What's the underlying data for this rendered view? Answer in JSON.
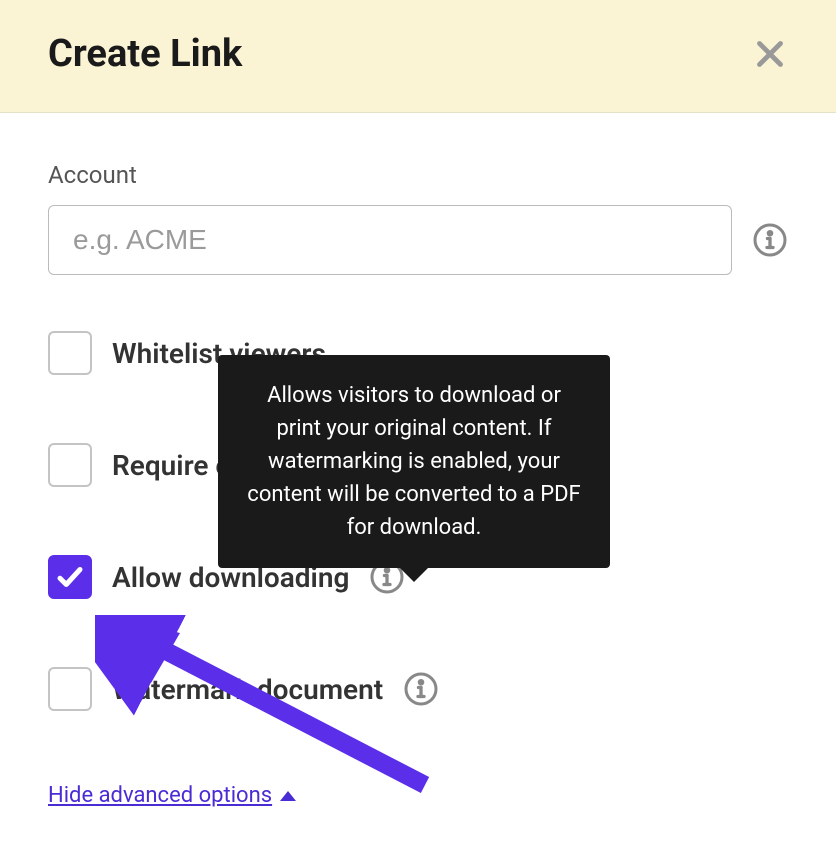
{
  "header": {
    "title": "Create Link"
  },
  "account": {
    "label": "Account",
    "placeholder": "e.g. ACME",
    "value": ""
  },
  "options": {
    "whitelist": {
      "label": "Whitelist viewers",
      "checked": false
    },
    "requireEmail": {
      "label": "Require email to view",
      "checked": false
    },
    "allowDownloading": {
      "label": "Allow downloading",
      "checked": true,
      "tooltip": "Allows visitors to download or print your original content. If watermarking is enabled, your content will be converted to a PDF for download."
    },
    "watermark": {
      "label": "Watermark document",
      "checked": false
    }
  },
  "advancedLink": "Hide advanced options "
}
